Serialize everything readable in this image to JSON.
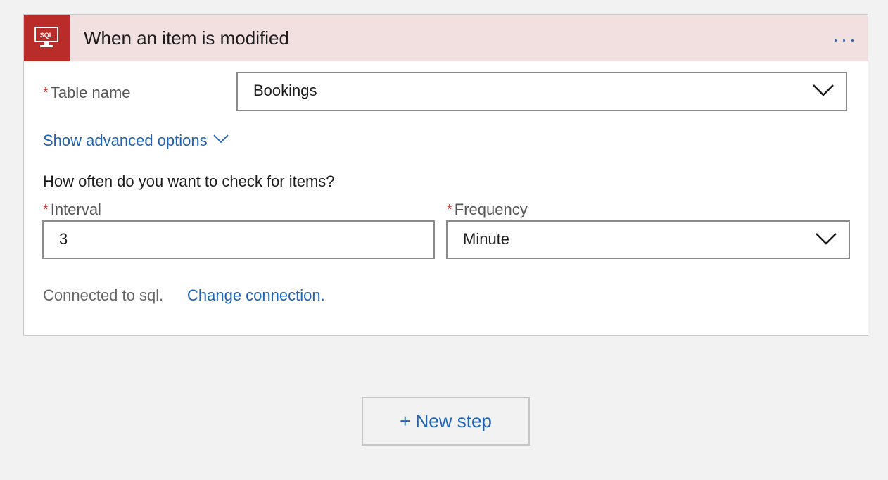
{
  "trigger": {
    "title": "When an item is modified",
    "icon": "sql-monitor-icon",
    "icon_text": "SQL",
    "header_color": "#f2dfdf",
    "icon_bg_color": "#ba2c2a",
    "required_marker": "*",
    "table": {
      "label": "Table name",
      "value": "Bookings"
    },
    "advanced_options_label": "Show advanced options",
    "schedule_question": "How often do you want to check for items?",
    "interval": {
      "label": "Interval",
      "value": "3"
    },
    "frequency": {
      "label": "Frequency",
      "value": "Minute"
    },
    "connection_status": "Connected to sql.",
    "change_connection_label": "Change connection."
  },
  "new_step": {
    "label": "+ New step"
  },
  "colors": {
    "link": "#1f63b6",
    "required": "#c4302b",
    "background": "#f2f2f2"
  }
}
